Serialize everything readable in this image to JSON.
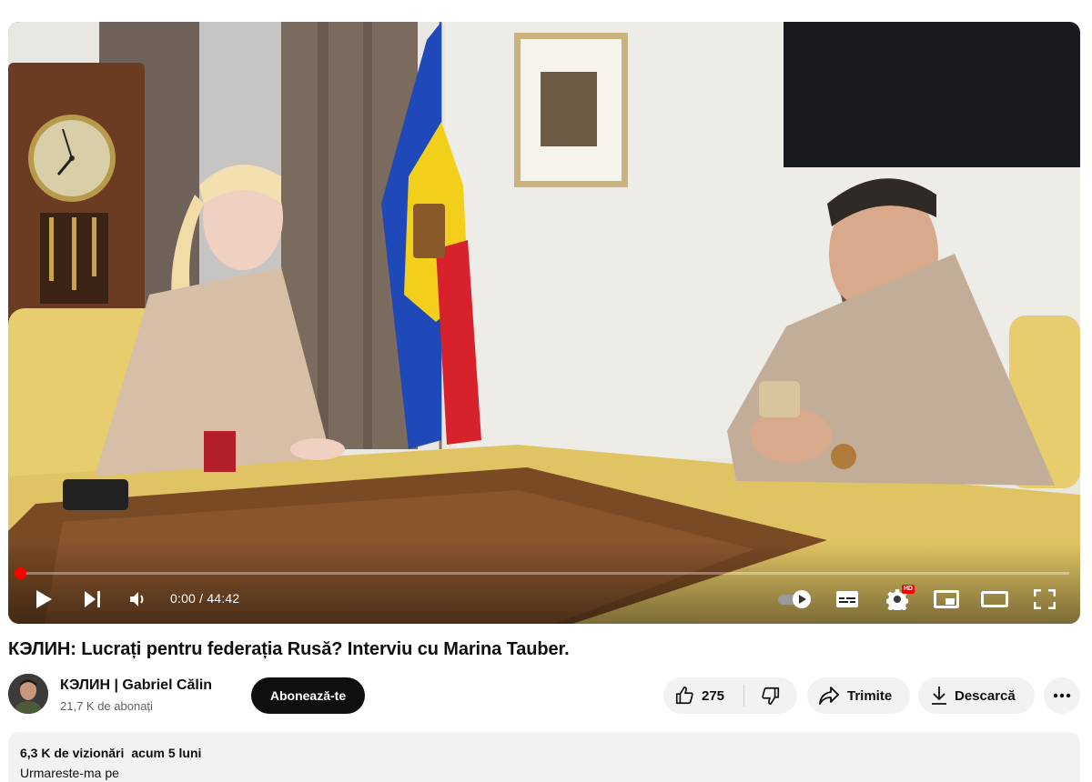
{
  "player": {
    "time_current": "0:00",
    "time_separator": "/",
    "time_total": "44:42",
    "progress_fraction": 0.0,
    "hd_badge": "HD",
    "accent_color": "#ff0000"
  },
  "video": {
    "title": "КЭЛИН: Lucrați pentru federația Rusă? Interviu cu Marina Tauber."
  },
  "channel": {
    "name": "КЭЛИН | Gabriel Călin",
    "subscribers": "21,7 K de abonați",
    "subscribe_label": "Abonează-te"
  },
  "actions": {
    "like_count": "275",
    "share_label": "Trimite",
    "download_label": "Descarcă"
  },
  "description": {
    "views": "6,3 K de vizionări",
    "date": "acum 5 luni",
    "text": "Urmareste-ma pe"
  },
  "icons": {
    "play": "play-icon",
    "next": "next-icon",
    "volume": "volume-icon",
    "autoplay": "autoplay-toggle-icon",
    "subtitles": "subtitles-icon",
    "settings": "settings-gear-icon",
    "miniplayer": "miniplayer-icon",
    "theater": "theater-mode-icon",
    "fullscreen": "fullscreen-icon",
    "like": "thumbs-up-icon",
    "dislike": "thumbs-down-icon",
    "share": "share-arrow-icon",
    "download": "download-icon",
    "more": "more-dots-icon"
  }
}
